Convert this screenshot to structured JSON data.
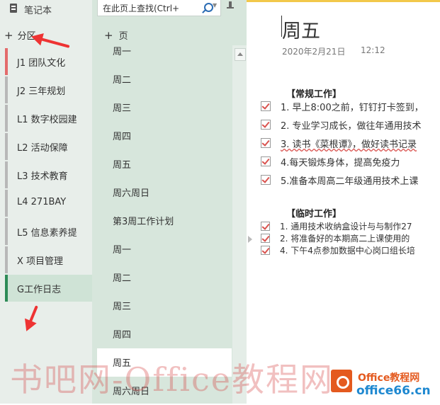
{
  "notebook": {
    "title": "笔记本"
  },
  "sections": {
    "add_label": "分区",
    "items": [
      {
        "label": "J1   团队文化",
        "color": "#e36b6b"
      },
      {
        "label": "J2    三年规划",
        "color": "#b8b8b8"
      },
      {
        "label": "L1   数字校园建",
        "color": "#b8b8b8"
      },
      {
        "label": "L2   活动保障",
        "color": "#b8b8b8"
      },
      {
        "label": "L3   技术教育",
        "color": "#b8b8b8"
      },
      {
        "label": "L4   271BAY",
        "color": "#b8b8b8"
      },
      {
        "label": "L5   信息素养提",
        "color": "#b8b8b8"
      },
      {
        "label": "X   项目管理",
        "color": "#b8b8b8"
      },
      {
        "label": "G工作日志",
        "color": "#2e8b57",
        "active": true
      }
    ]
  },
  "search": {
    "placeholder": "在此页上查找(Ctrl+",
    "icon": "search-icon"
  },
  "pages": {
    "add_label": "页",
    "items": [
      {
        "label": "周一"
      },
      {
        "label": "周二"
      },
      {
        "label": "周三"
      },
      {
        "label": "周四"
      },
      {
        "label": "周五"
      },
      {
        "label": "周六周日"
      },
      {
        "label": "第3周工作计划"
      },
      {
        "label": "周一"
      },
      {
        "label": "周二"
      },
      {
        "label": "周三"
      },
      {
        "label": "周四"
      },
      {
        "label": "周五",
        "active": true
      },
      {
        "label": "周六周日"
      }
    ]
  },
  "page": {
    "title": "周五",
    "date": "2020年2月21日",
    "time": "12:12",
    "regular_heading": "【常规工作】",
    "regular_todos": [
      "1. 早上8:00之前，钉钉打卡签到，",
      "2. 专业学习成长，做往年通用技术",
      "3. 读书《菜根谭》，做好读书记录",
      "4.每天锻炼身体，提高免疫力",
      "5.准备本周高二年级通用技术上课"
    ],
    "temp_heading": "【临时工作】",
    "temp_todos": [
      "1. 通用技术收纳盒设计与与制作27",
      "2. 将准备好的本期高二上课使用的",
      "4. 下午4点参加数据中心岗口组长培"
    ]
  },
  "watermark": {
    "text": "书吧网-Office教程网",
    "logo_top": "Office教程网",
    "logo_bottom": "office66.cn"
  },
  "colors": {
    "accent": "#2e8b57",
    "check": "#d9534f",
    "arrow": "#ee3333"
  }
}
